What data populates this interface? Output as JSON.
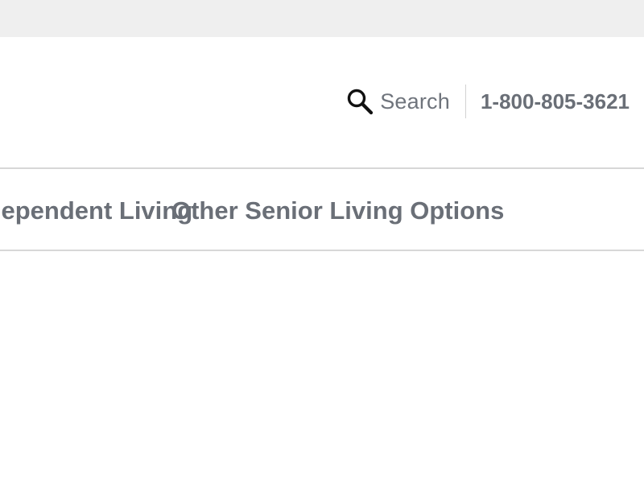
{
  "header": {
    "search": {
      "icon": "search-icon",
      "label": "Search"
    },
    "phone": "1-800-805-3621"
  },
  "nav": {
    "items": [
      {
        "label": "Independent Living"
      },
      {
        "label": "Other Senior Living Options"
      }
    ]
  },
  "colors": {
    "text_gray": "#6a6f77",
    "divider": "#d7d7d7",
    "top_strip": "#efefef"
  }
}
